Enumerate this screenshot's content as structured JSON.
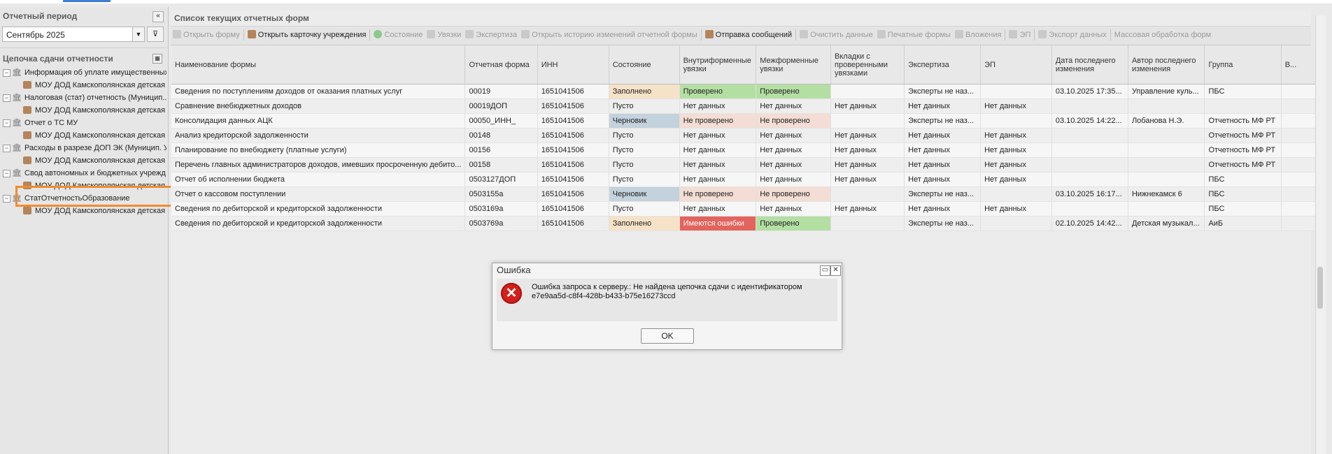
{
  "left_panel": {
    "period_title": "Отчетный период",
    "period_value": "Сентябрь 2025",
    "chain_title": "Цепочка сдачи отчетности",
    "tree": [
      {
        "label": "Информация об уплате имущественных",
        "type": "root"
      },
      {
        "label": "МОУ ДОД Камскополянская детская",
        "type": "child"
      },
      {
        "label": "Налоговая (стат) отчетность (Муницип...",
        "type": "root"
      },
      {
        "label": "МОУ ДОД Камскополянская детская",
        "type": "child"
      },
      {
        "label": "Отчет о ТС МУ",
        "type": "root"
      },
      {
        "label": "МОУ ДОД Камскополянская детская",
        "type": "child"
      },
      {
        "label": "Расходы в разрезе ДОП ЭК (Муницип. У",
        "type": "root"
      },
      {
        "label": "МОУ ДОД Камскополянская детская",
        "type": "child"
      },
      {
        "label": "Свод автономных и бюджетных учрежд",
        "type": "root"
      },
      {
        "label": "МОУ ДОД Камскополянская детская",
        "type": "child"
      },
      {
        "label": "СтатОтчетностьОбразование",
        "type": "root"
      },
      {
        "label": "МОУ ДОД Камскополянская детская",
        "type": "child"
      }
    ]
  },
  "right_panel": {
    "title": "Список текущих отчетных форм",
    "toolbar": [
      {
        "label": "Открыть форму",
        "enabled": false
      },
      {
        "label": "Открыть карточку учреждения",
        "enabled": true
      },
      {
        "label": "Состояние",
        "enabled": false
      },
      {
        "label": "Увязки",
        "enabled": false
      },
      {
        "label": "Экспертиза",
        "enabled": false
      },
      {
        "label": "Открыть историю изменений отчетной формы",
        "enabled": false
      },
      {
        "label": "Отправка сообщений",
        "enabled": true
      },
      {
        "label": "Очистить данные",
        "enabled": false
      },
      {
        "label": "Печатные формы",
        "enabled": false
      },
      {
        "label": "Вложения",
        "enabled": false
      },
      {
        "label": "ЭП",
        "enabled": false
      },
      {
        "label": "Экспорт данных",
        "enabled": false
      },
      {
        "label": "Массовая обработка форм",
        "enabled": false
      }
    ],
    "columns": [
      "Наименование формы",
      "Отчетная форма",
      "ИНН",
      "Состояние",
      "Внутриформенные увязки",
      "Межформенные увязки",
      "Вкладки с проверенными увязками",
      "Экспертиза",
      "ЭП",
      "Дата последнего изменения",
      "Автор последнего изменения",
      "Группа",
      "В..."
    ],
    "rows": [
      [
        "Сведения по поступлениям доходов от оказания платных услуг",
        "00019",
        "1651041506",
        "Заполнено",
        "Проверено",
        "Проверено",
        "",
        "Эксперты не наз...",
        "",
        "03.10.2025 17:35...",
        "Управление куль...",
        "ПБС"
      ],
      [
        "Сравнение внебюджетных доходов",
        "00019ДОП",
        "1651041506",
        "Пусто",
        "Нет данных",
        "Нет данных",
        "Нет данных",
        "Нет данных",
        "Нет данных",
        "",
        "",
        ""
      ],
      [
        "Консолидация данных АЦК",
        "00050_ИНН_",
        "1651041506",
        "Черновик",
        "Не проверено",
        "Не проверено",
        "",
        "Эксперты не наз...",
        "",
        "03.10.2025 14:22...",
        "Лобанова Н.Э.",
        "Отчетность МФ РТ"
      ],
      [
        "Анализ кредиторской задолженности",
        "00148",
        "1651041506",
        "Пусто",
        "Нет данных",
        "Нет данных",
        "Нет данных",
        "Нет данных",
        "Нет данных",
        "",
        "",
        "Отчетность МФ РТ"
      ],
      [
        "Планирование по внебюджету (платные услуги)",
        "00156",
        "1651041506",
        "Пусто",
        "Нет данных",
        "Нет данных",
        "Нет данных",
        "Нет данных",
        "Нет данных",
        "",
        "",
        "Отчетность МФ РТ"
      ],
      [
        "Перечень главных администраторов доходов, имевших просроченную дебито...",
        "00158",
        "1651041506",
        "Пусто",
        "Нет данных",
        "Нет данных",
        "Нет данных",
        "Нет данных",
        "Нет данных",
        "",
        "",
        "Отчетность МФ РТ"
      ],
      [
        "Отчет об исполнении бюджета",
        "0503127ДОП",
        "1651041506",
        "Пусто",
        "Нет данных",
        "Нет данных",
        "Нет данных",
        "Нет данных",
        "Нет данных",
        "",
        "",
        "ПБС"
      ],
      [
        "Отчет о кассовом поступлении",
        "0503155а",
        "1651041506",
        "Черновик",
        "Не проверено",
        "Не проверено",
        "",
        "Эксперты не наз...",
        "",
        "03.10.2025 16:17...",
        "Нижнекамск 6",
        "ПБС"
      ],
      [
        "Сведения по дебиторской и кредиторской задолженности",
        "0503169а",
        "1651041506",
        "Пусто",
        "Нет данных",
        "Нет данных",
        "Нет данных",
        "Нет данных",
        "Нет данных",
        "",
        "",
        "ПБС"
      ],
      [
        "Сведения по дебиторской и кредиторской задолженности",
        "0503769а",
        "1651041506",
        "Заполнено",
        "Имеются ошибки",
        "Проверено",
        "",
        "Эксперты не наз...",
        "",
        "02.10.2025 14:42...",
        "Детская музыкал...",
        "АиБ"
      ]
    ]
  },
  "dialog": {
    "title": "Ошибка",
    "message_line1": "Ошибка запроса к серверу.: Не найдена цепочка сдачи с идентификатором",
    "message_line2": "e7e9aa5d-c8f4-428b-b433-b75e16273ccd",
    "ok_label": "OK"
  }
}
